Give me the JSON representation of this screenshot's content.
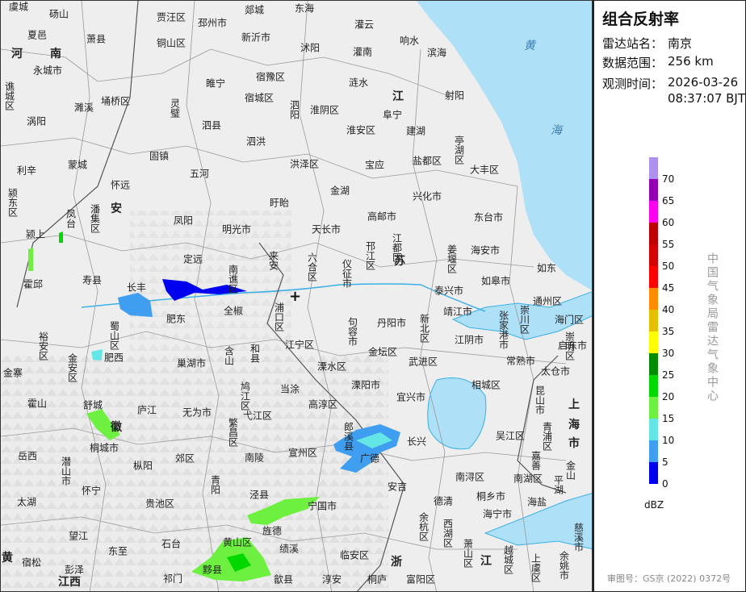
{
  "panel": {
    "title": "组合反射率",
    "station_label": "雷达站名：",
    "station": "南京",
    "range_label": "数据范围：",
    "range": "256 km",
    "time_label": "观测时间：",
    "date": "2026-03-26",
    "time": "08:37:07 BJT",
    "unit": "dBZ",
    "org": "中国气象局雷达气象中心",
    "approval": "审图号：GS京 (2022) 0372号"
  },
  "legend": {
    "ticks": [
      "0",
      "5",
      "10",
      "15",
      "20",
      "25",
      "30",
      "35",
      "40",
      "45",
      "50",
      "55",
      "60",
      "65",
      "70"
    ],
    "colors": [
      "#0000f0",
      "#3f9ef0",
      "#64e6e6",
      "#6ef040",
      "#00d800",
      "#008c00",
      "#ffff00",
      "#e6c000",
      "#ff8c00",
      "#ff0000",
      "#d60000",
      "#c00000",
      "#ff00f0",
      "#9600b4",
      "#ae90ee"
    ]
  },
  "map": {
    "radar_marker": "+",
    "sea_label": [
      "黄",
      "海"
    ],
    "provinces": [
      "河",
      "南",
      "安",
      "江",
      "苏",
      "浙",
      "江",
      "上",
      "海",
      "市",
      "江西",
      "黄",
      "徽"
    ],
    "places": [
      "虞城",
      "砀山",
      "贾汪区",
      "邳州市",
      "郯城",
      "东海",
      "灌云",
      "夏邑",
      "萧县",
      "铜山区",
      "新沂市",
      "沭阳",
      "灌南",
      "响水",
      "滨海",
      "永城市",
      "谯城区",
      "濉溪",
      "埇桥区",
      "灵璧",
      "睢宁",
      "宿豫区",
      "涟水",
      "涡阳",
      "泗县",
      "宿城区",
      "泗阳",
      "淮阴区",
      "阜宁",
      "射阳",
      "淮安区",
      "建湖",
      "亭湖区",
      "利辛",
      "蒙城",
      "固镇",
      "泗洪",
      "洪泽区",
      "宝应",
      "盐都区",
      "大丰区",
      "颍东区",
      "怀远",
      "五河",
      "盱眙",
      "金湖",
      "兴化市",
      "凤台",
      "潘集区",
      "凤阳",
      "明光市",
      "天长市",
      "高邮市",
      "东台市",
      "颍上",
      "定远",
      "来安",
      "六合区",
      "仪征市",
      "邗江区",
      "江都区",
      "姜堰区",
      "海安市",
      "如东",
      "霍邱",
      "寿县",
      "长丰",
      "南谯区",
      "如皋市",
      "泰兴市",
      "肥东",
      "全椒",
      "浦口区",
      "靖江市",
      "张家港市",
      "通州区",
      "海门区",
      "崇川区",
      "裕安区",
      "蜀山区",
      "肥西",
      "江宁区",
      "句容市",
      "丹阳市",
      "新北区",
      "江阴市",
      "常熟市",
      "启东市",
      "金安区",
      "巢湖市",
      "含山",
      "和县",
      "溧水区",
      "金坛区",
      "武进区",
      "太仓市",
      "金寨",
      "当涂",
      "溧阳市",
      "宜兴市",
      "相城区",
      "昆山市",
      "霍山",
      "舒城",
      "庐江",
      "鸠江区",
      "弋江区",
      "高淳区",
      "无为市",
      "繁昌区",
      "郎溪县",
      "宣州区",
      "长兴",
      "吴江区",
      "青浦区",
      "岳西",
      "桐城市",
      "潜山市",
      "枞阳",
      "郊区",
      "南陵",
      "广德",
      "嘉善",
      "金山",
      "太湖",
      "怀宁",
      "贵池区",
      "青阳",
      "泾县",
      "宁国市",
      "安吉",
      "德清",
      "南浔区",
      "桐乡市",
      "南湖区",
      "平湖",
      "海宁市",
      "海盐",
      "望江",
      "东至",
      "石台",
      "黄山区",
      "旌德",
      "绩溪",
      "余杭区",
      "西湖区",
      "慈溪市",
      "宿松",
      "彭泽",
      "祁门",
      "黟县",
      "歙县",
      "临安区",
      "淳安",
      "桐庐",
      "富阳区",
      "萧山区",
      "越城区",
      "上虞区",
      "余姚市",
      "崇明区"
    ]
  }
}
